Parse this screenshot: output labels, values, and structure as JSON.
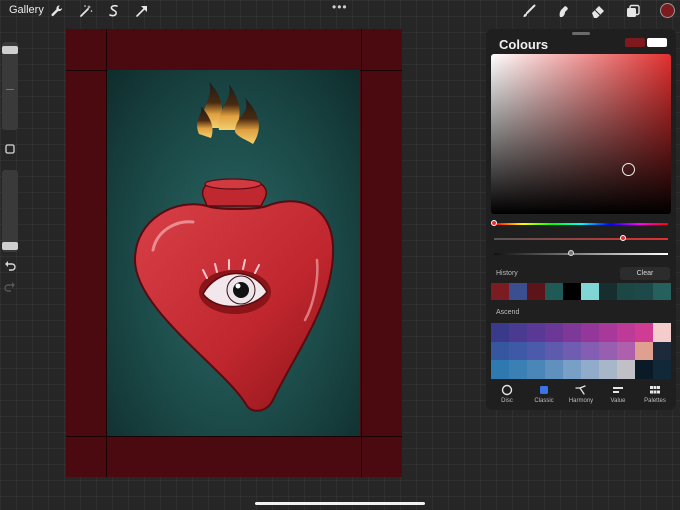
{
  "topbar": {
    "gallery_label": "Gallery",
    "left_tools": [
      "wrench-icon",
      "magic-wand-icon",
      "selection-icon",
      "transform-arrow-icon"
    ],
    "more_label": "•••",
    "right_tools": [
      "brush-icon",
      "smudge-icon",
      "eraser-icon",
      "layers-icon"
    ],
    "current_color": "#7c1a1e"
  },
  "sidebar": {
    "buttons": [
      "modify-square-icon",
      "undo-icon",
      "redo-icon"
    ]
  },
  "canvas": {
    "frame_color": "#4b0a10",
    "background_color": "#1b4a48",
    "artwork": "red-heart-with-eye-and-flame"
  },
  "colours_panel": {
    "title": "Colours",
    "primary_color": "#7c1a1e",
    "secondary_color": "#ffffff",
    "hue_color": "#e22f2f",
    "history_label": "History",
    "clear_label": "Clear",
    "history_colors": [
      "#7a1c22",
      "#3a4f8f",
      "#5c1418",
      "#1f5a57",
      "#000000",
      "#7fd6d4",
      "#162e2e",
      "#1b4744",
      "#1d4a48",
      "#25605c"
    ],
    "palette_label": "Ascend",
    "palette_colors": [
      "#3a3a8a",
      "#4a3a90",
      "#5a3896",
      "#6b3898",
      "#7e3898",
      "#93389a",
      "#a8389a",
      "#bd3a98",
      "#d03c94",
      "#f4cccc",
      "#3656a0",
      "#3e5aa6",
      "#4c5aac",
      "#5e5aae",
      "#705cb0",
      "#845eb2",
      "#985eb0",
      "#ae60ac",
      "#e0a090",
      "#1e2a3a",
      "#2e7ab0",
      "#3a80b4",
      "#4a86b8",
      "#6090be",
      "#78a0c6",
      "#90acca",
      "#a8b6ca",
      "#c0c0c6",
      "#0a1a26",
      "#102838"
    ],
    "tabs": [
      {
        "label": "Disc",
        "icon": "disc-icon"
      },
      {
        "label": "Classic",
        "icon": "classic-square-icon"
      },
      {
        "label": "Harmony",
        "icon": "harmony-icon"
      },
      {
        "label": "Value",
        "icon": "value-sliders-icon"
      },
      {
        "label": "Palettes",
        "icon": "palettes-grid-icon"
      }
    ],
    "active_tab": "Classic"
  }
}
